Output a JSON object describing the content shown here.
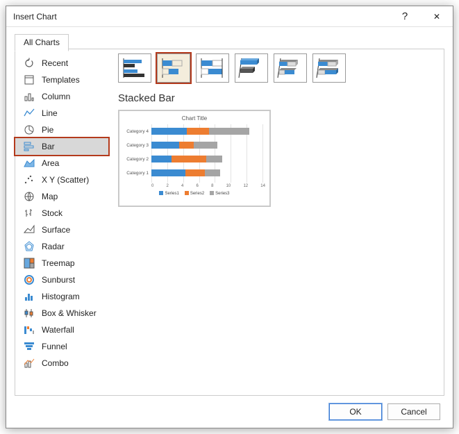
{
  "dialog": {
    "title": "Insert Chart",
    "help_glyph": "?",
    "close_glyph": "✕"
  },
  "tabs": {
    "active": "All Charts"
  },
  "sidebar": {
    "items": [
      {
        "label": "Recent"
      },
      {
        "label": "Templates"
      },
      {
        "label": "Column"
      },
      {
        "label": "Line"
      },
      {
        "label": "Pie"
      },
      {
        "label": "Bar"
      },
      {
        "label": "Area"
      },
      {
        "label": "X Y (Scatter)"
      },
      {
        "label": "Map"
      },
      {
        "label": "Stock"
      },
      {
        "label": "Surface"
      },
      {
        "label": "Radar"
      },
      {
        "label": "Treemap"
      },
      {
        "label": "Sunburst"
      },
      {
        "label": "Histogram"
      },
      {
        "label": "Box & Whisker"
      },
      {
        "label": "Waterfall"
      },
      {
        "label": "Funnel"
      },
      {
        "label": "Combo"
      }
    ],
    "selected_index": 5
  },
  "subtype": {
    "selected_index": 1,
    "section_title": "Stacked Bar"
  },
  "preview": {
    "title": "Chart Title",
    "legend": [
      "Series1",
      "Series2",
      "Series3"
    ]
  },
  "footer": {
    "ok": "OK",
    "cancel": "Cancel"
  },
  "chart_data": {
    "type": "bar",
    "orientation": "horizontal",
    "stacked": true,
    "title": "Chart Title",
    "xlabel": "",
    "ylabel": "",
    "xlim": [
      0,
      14
    ],
    "xticks": [
      0,
      2,
      4,
      6,
      8,
      10,
      12,
      14
    ],
    "categories": [
      "Category 4",
      "Category 3",
      "Category 2",
      "Category 1"
    ],
    "series": [
      {
        "name": "Series1",
        "values": [
          4.5,
          3.5,
          2.5,
          4.3
        ],
        "color": "#3b8bd1"
      },
      {
        "name": "Series2",
        "values": [
          2.8,
          1.8,
          4.4,
          2.4
        ],
        "color": "#ed7d31"
      },
      {
        "name": "Series3",
        "values": [
          5.0,
          3.0,
          2.0,
          2.0
        ],
        "color": "#a5a5a5"
      }
    ]
  }
}
